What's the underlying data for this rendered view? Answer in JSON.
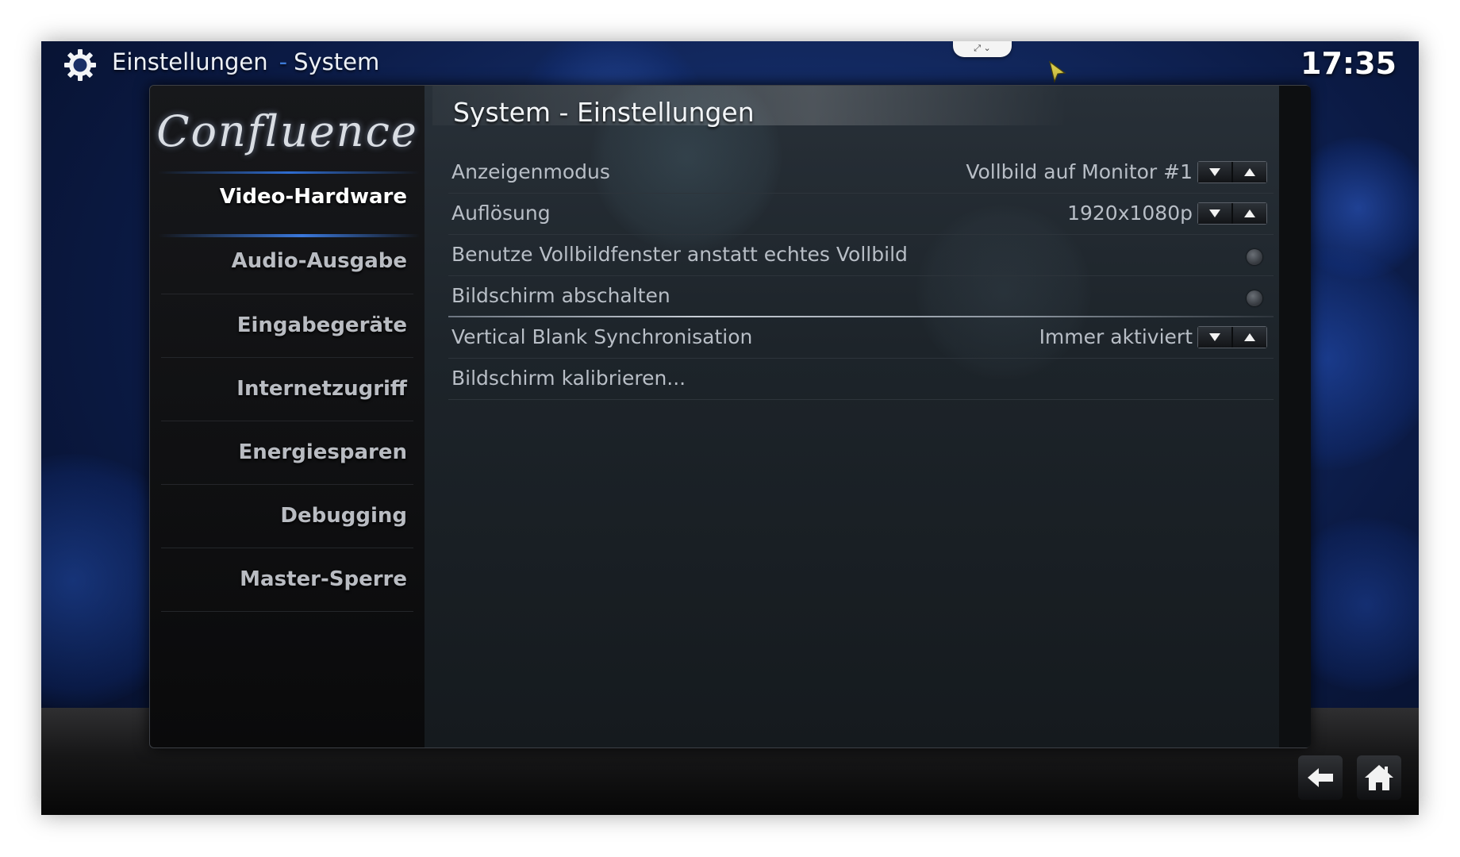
{
  "header": {
    "section": "Einstellungen",
    "separator": "-",
    "page": "System",
    "clock": "17:35",
    "top_tab_icons": [
      "expand-icon",
      "chevron-down-icon"
    ]
  },
  "sidebar": {
    "logo": "Confluence",
    "items": [
      {
        "label": "Video-Hardware",
        "active": true
      },
      {
        "label": "Audio-Ausgabe",
        "active": false
      },
      {
        "label": "Eingabegeräte",
        "active": false
      },
      {
        "label": "Internetzugriff",
        "active": false
      },
      {
        "label": "Energiesparen",
        "active": false
      },
      {
        "label": "Debugging",
        "active": false
      },
      {
        "label": "Master-Sperre",
        "active": false
      }
    ]
  },
  "dialog": {
    "title": "System - Einstellungen",
    "close_label": "×",
    "settings": [
      {
        "label": "Anzeigenmodus",
        "value": "Vollbild auf Monitor #1",
        "control": "spinner"
      },
      {
        "label": "Auflösung",
        "value": "1920x1080p",
        "control": "spinner"
      },
      {
        "label": "Benutze Vollbildfenster anstatt echtes Vollbild",
        "control": "radio",
        "checked": false
      },
      {
        "label": "Bildschirm abschalten",
        "control": "radio",
        "checked": false
      },
      {
        "label": "Vertical Blank Synchronisation",
        "value": "Immer aktiviert",
        "control": "spinner"
      },
      {
        "label": "Bildschirm kalibrieren...",
        "control": "button"
      }
    ]
  },
  "footer": {
    "icons": [
      "back-arrow-icon",
      "home-icon"
    ]
  },
  "colors": {
    "accent": "#3d7ad8",
    "background": "#142c66",
    "dialog": "#0d0e10"
  }
}
